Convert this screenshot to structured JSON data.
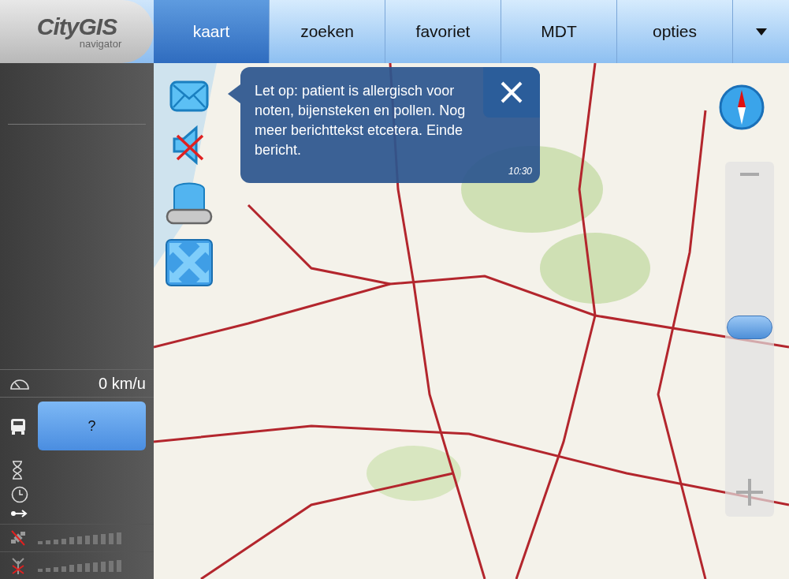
{
  "logo": {
    "name": "CityGIS",
    "subtitle": "navigator"
  },
  "tabs": [
    {
      "label": "kaart",
      "selected": true
    },
    {
      "label": "zoeken",
      "selected": false
    },
    {
      "label": "favoriet",
      "selected": false
    },
    {
      "label": "MDT",
      "selected": false
    },
    {
      "label": "opties",
      "selected": false
    }
  ],
  "message": {
    "text": "Let op: patient is allergisch voor noten, bijensteken en pollen. Nog meer berichttekst etcetera. Einde bericht.",
    "time": "10:30"
  },
  "status": {
    "speed": "0 km/u",
    "vehicle_button": "?"
  },
  "zoom": {
    "level": 0.5
  }
}
